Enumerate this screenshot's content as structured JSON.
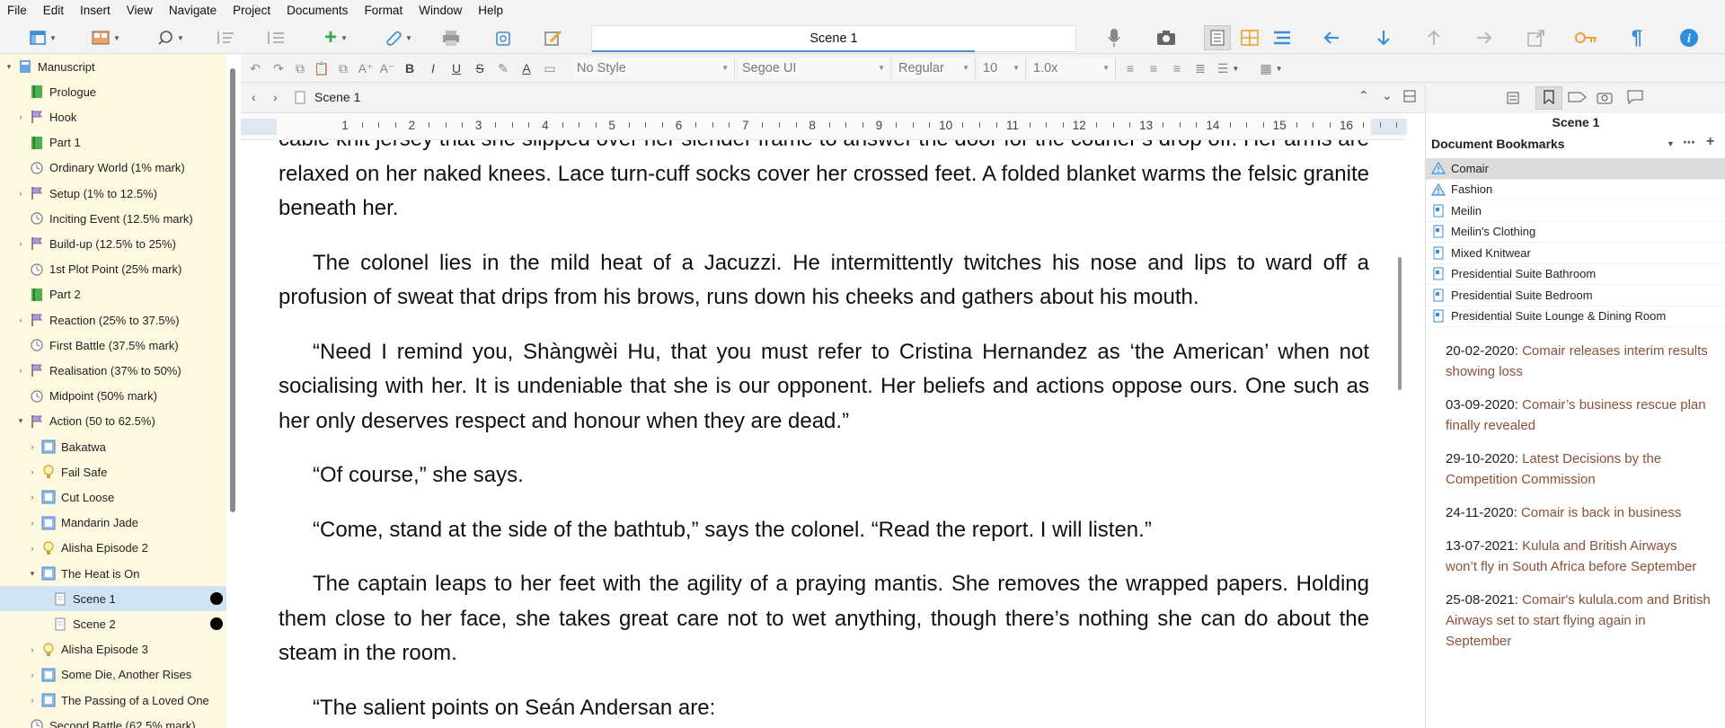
{
  "menu": [
    "File",
    "Edit",
    "Insert",
    "View",
    "Navigate",
    "Project",
    "Documents",
    "Format",
    "Window",
    "Help"
  ],
  "title_field": "Scene 1",
  "format": {
    "style": "No Style",
    "font": "Segoe UI",
    "weight": "Regular",
    "size": "10",
    "spacing": "1.0x"
  },
  "editor_header": {
    "doc_title": "Scene 1"
  },
  "ruler": [
    "1",
    "2",
    "3",
    "4",
    "5",
    "6",
    "7",
    "8",
    "9",
    "10",
    "11",
    "12",
    "13",
    "14",
    "15",
    "16"
  ],
  "binder": {
    "items": [
      {
        "label": "Manuscript"
      },
      {
        "label": "Prologue"
      },
      {
        "label": "Hook"
      },
      {
        "label": "Part 1"
      },
      {
        "label": "Ordinary World (1% mark)"
      },
      {
        "label": "Setup (1% to 12.5%)"
      },
      {
        "label": "Inciting Event (12.5% mark)"
      },
      {
        "label": "Build-up (12.5% to 25%)"
      },
      {
        "label": "1st Plot Point (25% mark)"
      },
      {
        "label": "Part 2"
      },
      {
        "label": "Reaction (25% to 37.5%)"
      },
      {
        "label": "First Battle (37.5% mark)"
      },
      {
        "label": "Realisation (37% to 50%)"
      },
      {
        "label": "Midpoint (50% mark)"
      },
      {
        "label": "Action (50 to 62.5%)"
      },
      {
        "label": "Bakatwa"
      },
      {
        "label": "Fail Safe"
      },
      {
        "label": "Cut Loose"
      },
      {
        "label": "Mandarin Jade"
      },
      {
        "label": "Alisha Episode 2"
      },
      {
        "label": "The Heat is On"
      },
      {
        "label": "Scene 1"
      },
      {
        "label": "Scene 2"
      },
      {
        "label": "Alisha Episode 3"
      },
      {
        "label": "Some Die, Another Rises"
      },
      {
        "label": "The Passing of a Loved One"
      },
      {
        "label": "Second Battle (62.5% mark)"
      }
    ]
  },
  "document": {
    "paragraphs": [
      "cable knit jersey that she slipped over her slender frame to answer the door for the courier’s drop off. Her arms are relaxed on her naked knees. Lace turn-cuff socks cover her crossed feet. A folded blanket warms the felsic granite beneath her.",
      "The colonel lies in the mild heat of a Jacuzzi. He intermittently twitches his nose and lips to ward off a profusion of sweat that drips from his brows, runs down his cheeks and gathers about his mouth.",
      "“Need I remind you, Shàngwèi Hu, that you must refer to Cristina Hernandez as ‘the American’ when not socialising with her. It is undeniable that she is our opponent. Her beliefs and actions oppose ours. One such as her only deserves respect and honour when they are dead.”",
      "“Of course,” she says.",
      "“Come, stand at the side of the bathtub,” says the colonel. “Read the report. I will listen.”",
      "The captain leaps to her feet with the agility of a praying mantis. She removes the wrapped papers. Holding them close to her face, she takes great care not to wet anything, though there’s nothing she can do about the steam in the room.",
      "“The salient points on Seán Andersan are:"
    ]
  },
  "inspector": {
    "title": "Scene 1",
    "bookmarks_header": "Document Bookmarks",
    "bookmarks": [
      {
        "label": "Comair",
        "icon": "warning"
      },
      {
        "label": "Fashion",
        "icon": "warning"
      },
      {
        "label": "Meilin",
        "icon": "doc"
      },
      {
        "label": "Meilin's Clothing",
        "icon": "doc"
      },
      {
        "label": "Mixed Knitwear",
        "icon": "doc"
      },
      {
        "label": "Presidential Suite Bathroom",
        "icon": "doc"
      },
      {
        "label": "Presidential Suite Bedroom",
        "icon": "doc"
      },
      {
        "label": "Presidential Suite Lounge & Dining Room",
        "icon": "doc"
      }
    ],
    "notes": [
      {
        "date": "20-02-2020:",
        "text": "Comair releases interim results showing loss"
      },
      {
        "date": "03-09-2020:",
        "text": "Comair’s business rescue plan finally revealed"
      },
      {
        "date": "29-10-2020:",
        "text": "Latest Decisions by the Competition Commission"
      },
      {
        "date": "24-11-2020:",
        "text": "Comair is back in business"
      },
      {
        "date": "13-07-2021:",
        "text": "Kulula and British Airways won’t fly in South Africa before September"
      },
      {
        "date": "25-08-2021:",
        "text": "Comair's kulula.com and British Airways set to start flying again in September"
      }
    ]
  },
  "colors": {
    "binder_bg": "#fff8e0",
    "selection": "#cfe3f3",
    "accent_blue": "#2f8fdc",
    "note_link": "#8b5138"
  }
}
